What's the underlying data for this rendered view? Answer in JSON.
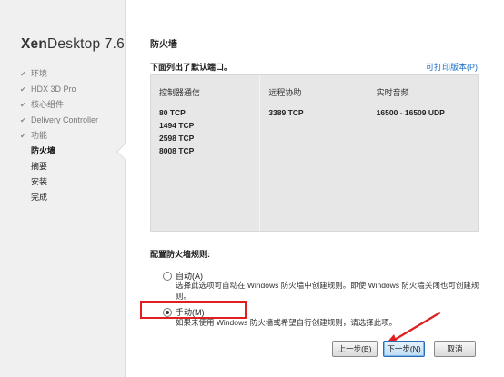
{
  "brand": {
    "prefix": "Xen",
    "suffix": "Desktop 7.6"
  },
  "sidebar": {
    "steps": [
      {
        "label": "环境",
        "state": "done"
      },
      {
        "label": "HDX 3D Pro",
        "state": "done"
      },
      {
        "label": "核心组件",
        "state": "done"
      },
      {
        "label": "Delivery Controller",
        "state": "done"
      },
      {
        "label": "功能",
        "state": "done"
      },
      {
        "label": "防火墙",
        "state": "current"
      },
      {
        "label": "摘要",
        "state": "pending"
      },
      {
        "label": "安装",
        "state": "pending"
      },
      {
        "label": "完成",
        "state": "pending"
      }
    ]
  },
  "main": {
    "title": "防火墙",
    "section_label": "下面列出了默认端口。",
    "print_link": "可打印版本(P)",
    "ports": [
      {
        "header": "控制器通信",
        "values": [
          "80 TCP",
          "1494 TCP",
          "2598 TCP",
          "8008 TCP"
        ]
      },
      {
        "header": "远程协助",
        "values": [
          "3389 TCP"
        ]
      },
      {
        "header": "实时音频",
        "values": [
          "16500 - 16509 UDP"
        ]
      }
    ],
    "rules_label": "配置防火墙规则:",
    "options": {
      "auto": {
        "label": "自动(A)",
        "desc": "选择此选项可自动在 Windows 防火墙中创建规则。即使 Windows 防火墙关闭也可创建规则。",
        "checked": false
      },
      "manual": {
        "label": "手动(M)",
        "desc": "如果未使用 Windows 防火墙或希望自行创建规则，请选择此项。",
        "checked": true
      }
    }
  },
  "buttons": {
    "back": "上一步(B)",
    "next": "下一步(N)",
    "cancel": "取消"
  },
  "colors": {
    "link": "#1a6fc8",
    "highlight": "#e02020",
    "sidebar_bg": "#f0f0f0",
    "table_bg": "#e7e7e7"
  }
}
